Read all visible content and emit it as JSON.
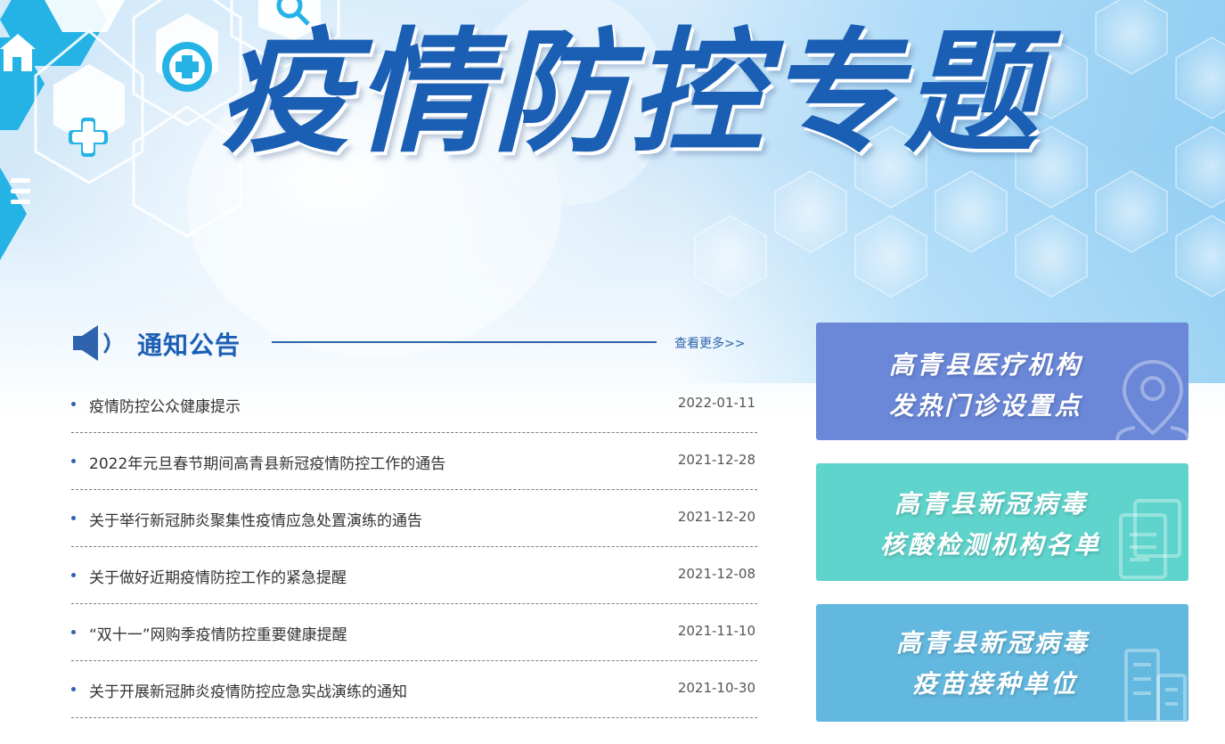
{
  "banner": {
    "title": "疫情防控专题"
  },
  "notice_section": {
    "title": "通知公告",
    "more_label": "查看更多>>",
    "items": [
      {
        "title": "疫情防控公众健康提示",
        "date": "2022-01-11"
      },
      {
        "title": "2022年元旦春节期间高青县新冠疫情防控工作的通告",
        "date": "2021-12-28"
      },
      {
        "title": "关于举行新冠肺炎聚集性疫情应急处置演练的通告",
        "date": "2021-12-20"
      },
      {
        "title": "关于做好近期疫情防控工作的紧急提醒",
        "date": "2021-12-08"
      },
      {
        "title": "“双十一”网购季疫情防控重要健康提醒",
        "date": "2021-11-10"
      },
      {
        "title": "关于开展新冠肺炎疫情防控应急实战演练的通知",
        "date": "2021-10-30"
      }
    ]
  },
  "cards": [
    {
      "line1": "高青县医疗机构",
      "line2": "发热门诊设置点",
      "color": "#6a87d8",
      "icon": "location-pin-icon"
    },
    {
      "line1": "高青县新冠病毒",
      "line2": "核酸检测机构名单",
      "color": "#5fd4cc",
      "icon": "document-icon"
    },
    {
      "line1": "高青县新冠病毒",
      "line2": "疫苗接种单位",
      "color": "#62b8de",
      "icon": "building-icon"
    }
  ],
  "colors": {
    "brand_blue": "#1b5fb4",
    "accent_blue": "#2f63ad",
    "hex_cyan": "#25b3e6"
  }
}
